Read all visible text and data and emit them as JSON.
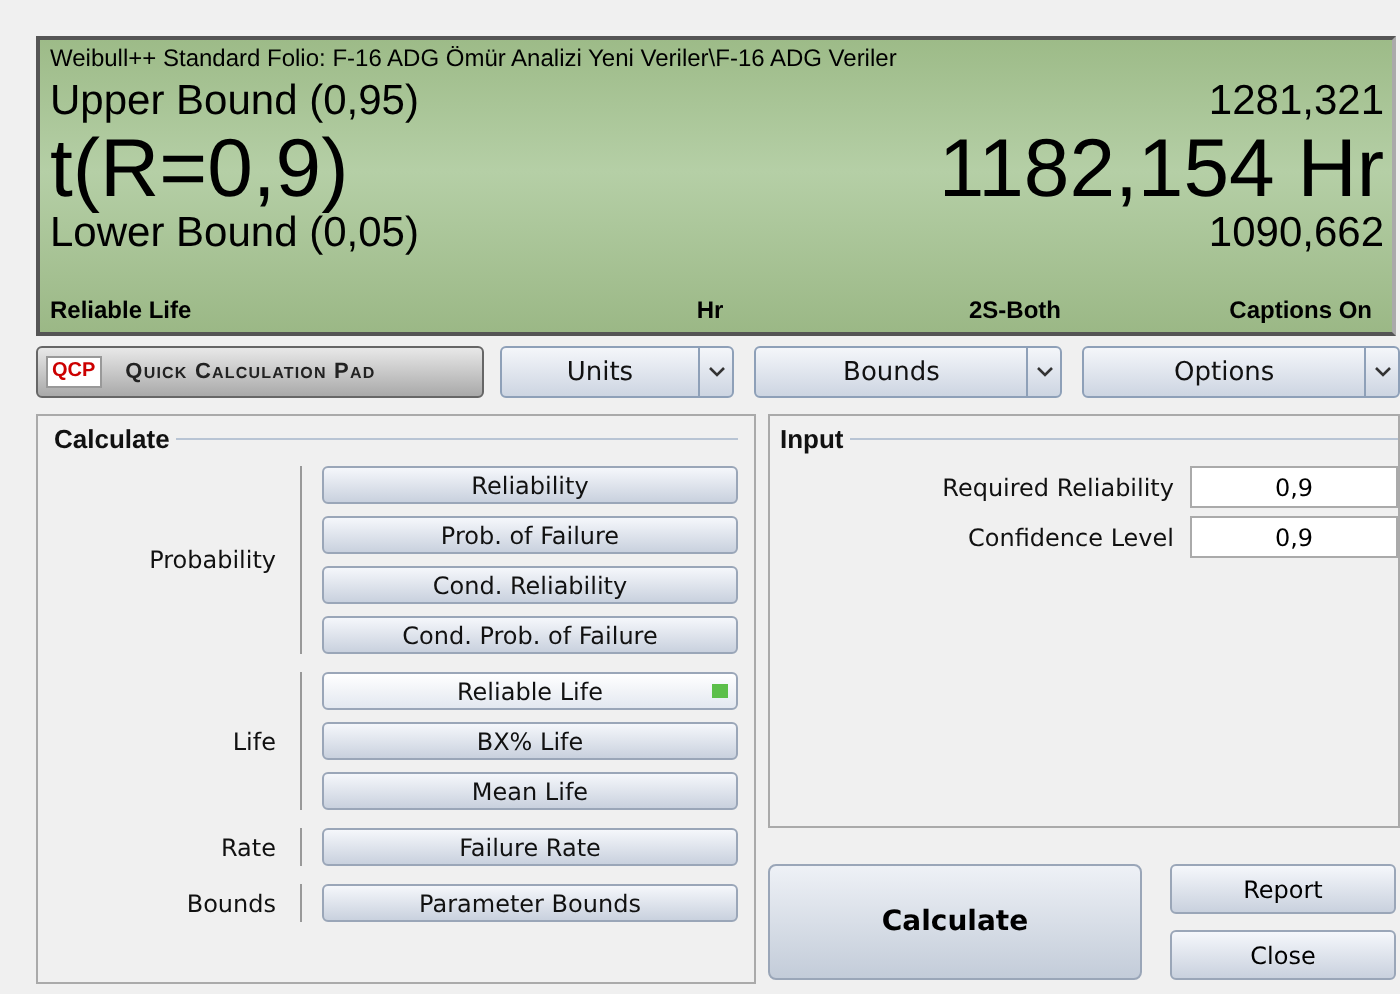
{
  "display": {
    "title": "Weibull++ Standard Folio: F-16 ADG Ömür Analizi Yeni Veriler\\F-16 ADG Veriler",
    "upper_label": "Upper Bound (0,95)",
    "upper_value": "1281,321",
    "main_label": "t(R=0,9)",
    "main_value": "1182,154 Hr",
    "lower_label": "Lower Bound (0,05)",
    "lower_value": "1090,662",
    "footer": [
      "Reliable Life",
      "Hr",
      "2S-Both",
      "Captions On"
    ]
  },
  "toolbar": {
    "logo": "QCP",
    "pad_button": "Quick Calculation Pad",
    "dropdowns": [
      "Units",
      "Bounds",
      "Options"
    ]
  },
  "calculate": {
    "title": "Calculate",
    "groups": [
      {
        "label": "Probability",
        "buttons": [
          {
            "label": "Reliability",
            "selected": false
          },
          {
            "label": "Prob. of Failure",
            "selected": false
          },
          {
            "label": "Cond. Reliability",
            "selected": false
          },
          {
            "label": "Cond. Prob. of Failure",
            "selected": false
          }
        ]
      },
      {
        "label": "Life",
        "buttons": [
          {
            "label": "Reliable Life",
            "selected": true
          },
          {
            "label": "BX% Life",
            "selected": false
          },
          {
            "label": "Mean Life",
            "selected": false
          }
        ]
      },
      {
        "label": "Rate",
        "buttons": [
          {
            "label": "Failure Rate",
            "selected": false
          }
        ]
      },
      {
        "label": "Bounds",
        "buttons": [
          {
            "label": "Parameter Bounds",
            "selected": false
          }
        ]
      }
    ]
  },
  "input": {
    "title": "Input",
    "fields": [
      {
        "label": "Required Reliability",
        "value": "0,9"
      },
      {
        "label": "Confidence Level",
        "value": "0,9"
      }
    ]
  },
  "actions": {
    "calculate": "Calculate",
    "report": "Report",
    "close": "Close"
  }
}
